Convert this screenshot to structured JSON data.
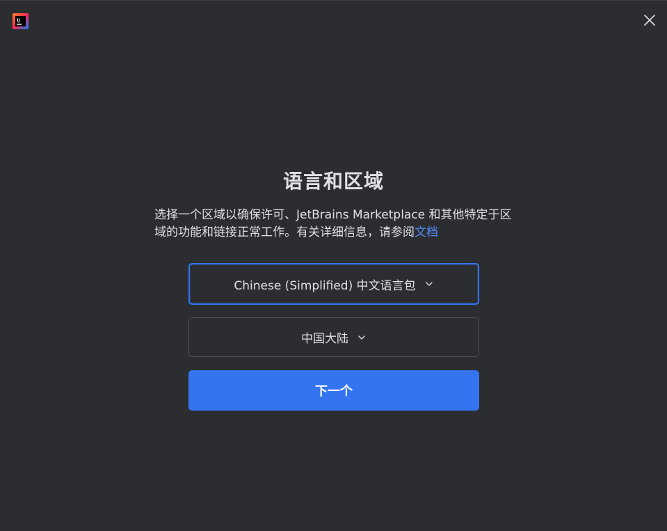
{
  "window": {
    "close_icon": "close-icon",
    "logo_icon": "intellij-idea-logo"
  },
  "title": "语言和区域",
  "description": {
    "text": "选择一个区域以确保许可、JetBrains Marketplace 和其他特定于区域的功能和链接正常工作。有关详细信息，请参阅",
    "link_text": "文档"
  },
  "language_select": {
    "value": "Chinese (Simplified) 中文语言包",
    "icon": "chevron-down-icon"
  },
  "region_select": {
    "value": "中国大陆",
    "icon": "chevron-down-icon"
  },
  "next_button": {
    "label": "下一个"
  },
  "colors": {
    "background": "#2b2d30",
    "accent": "#3574f0",
    "link": "#548af7",
    "text": "#dfe1e5",
    "border": "#4e5157"
  }
}
